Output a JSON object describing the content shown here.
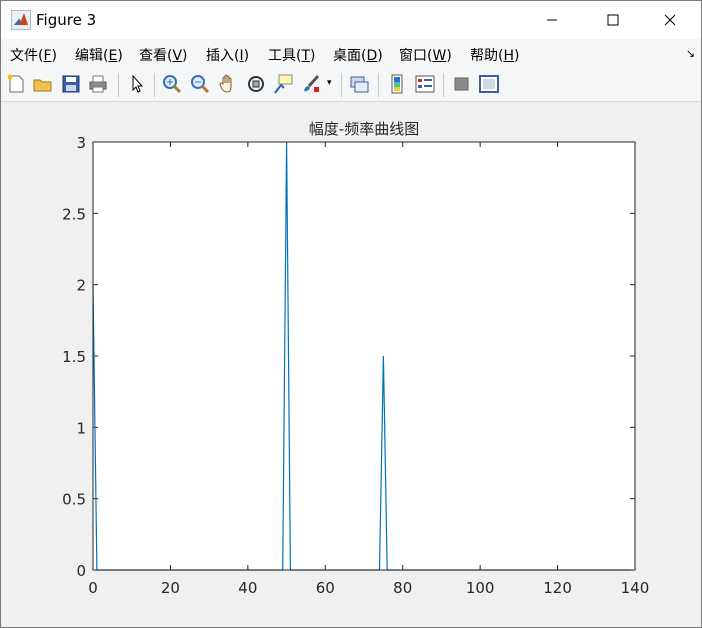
{
  "window": {
    "title": "Figure 3",
    "minimize_icon": "minimize-icon",
    "maximize_icon": "maximize-icon",
    "close_icon": "close-icon"
  },
  "menu": [
    {
      "label": "文件(",
      "key": "F",
      "tail": ")"
    },
    {
      "label": "编辑(",
      "key": "E",
      "tail": ")"
    },
    {
      "label": "查看(",
      "key": "V",
      "tail": ")"
    },
    {
      "label": "插入(",
      "key": "I",
      "tail": ")"
    },
    {
      "label": "工具(",
      "key": "T",
      "tail": ")"
    },
    {
      "label": "桌面(",
      "key": "D",
      "tail": ")"
    },
    {
      "label": "窗口(",
      "key": "W",
      "tail": ")"
    },
    {
      "label": "帮助(",
      "key": "H",
      "tail": ")"
    }
  ],
  "toolbar": [
    "new-figure-icon",
    "open-file-icon",
    "save-icon",
    "print-icon",
    "pointer-icon",
    "zoom-in-icon",
    "zoom-out-icon",
    "pan-hand-icon",
    "rotate-3d-icon",
    "data-cursor-icon",
    "brush-icon",
    "link-plot-icon",
    "colorbar-icon",
    "legend-icon",
    "hide-plot-tools-icon",
    "show-plot-tools-icon"
  ],
  "colors": {
    "line": "#0072bd",
    "axes_bg": "#ffffff",
    "figure_bg": "#f0f0f0"
  },
  "chart_data": {
    "type": "line",
    "title": "幅度-频率曲线图",
    "xlabel": "",
    "ylabel": "",
    "xlim": [
      0,
      140
    ],
    "ylim": [
      0,
      3
    ],
    "xticks": [
      0,
      20,
      40,
      60,
      80,
      100,
      120,
      140
    ],
    "yticks": [
      0,
      0.5,
      1,
      1.5,
      2,
      2.5,
      3
    ],
    "ytick_labels": [
      "0",
      "0.5",
      "1",
      "1.5",
      "2",
      "2.5",
      "3"
    ],
    "grid": false,
    "series": [
      {
        "x": [
          0,
          1,
          2,
          49,
          50,
          51,
          52,
          74,
          75,
          76,
          77,
          139
        ],
        "y": [
          2,
          0,
          0,
          0,
          3,
          0,
          0,
          0,
          1.5,
          0,
          0,
          0
        ]
      }
    ]
  }
}
